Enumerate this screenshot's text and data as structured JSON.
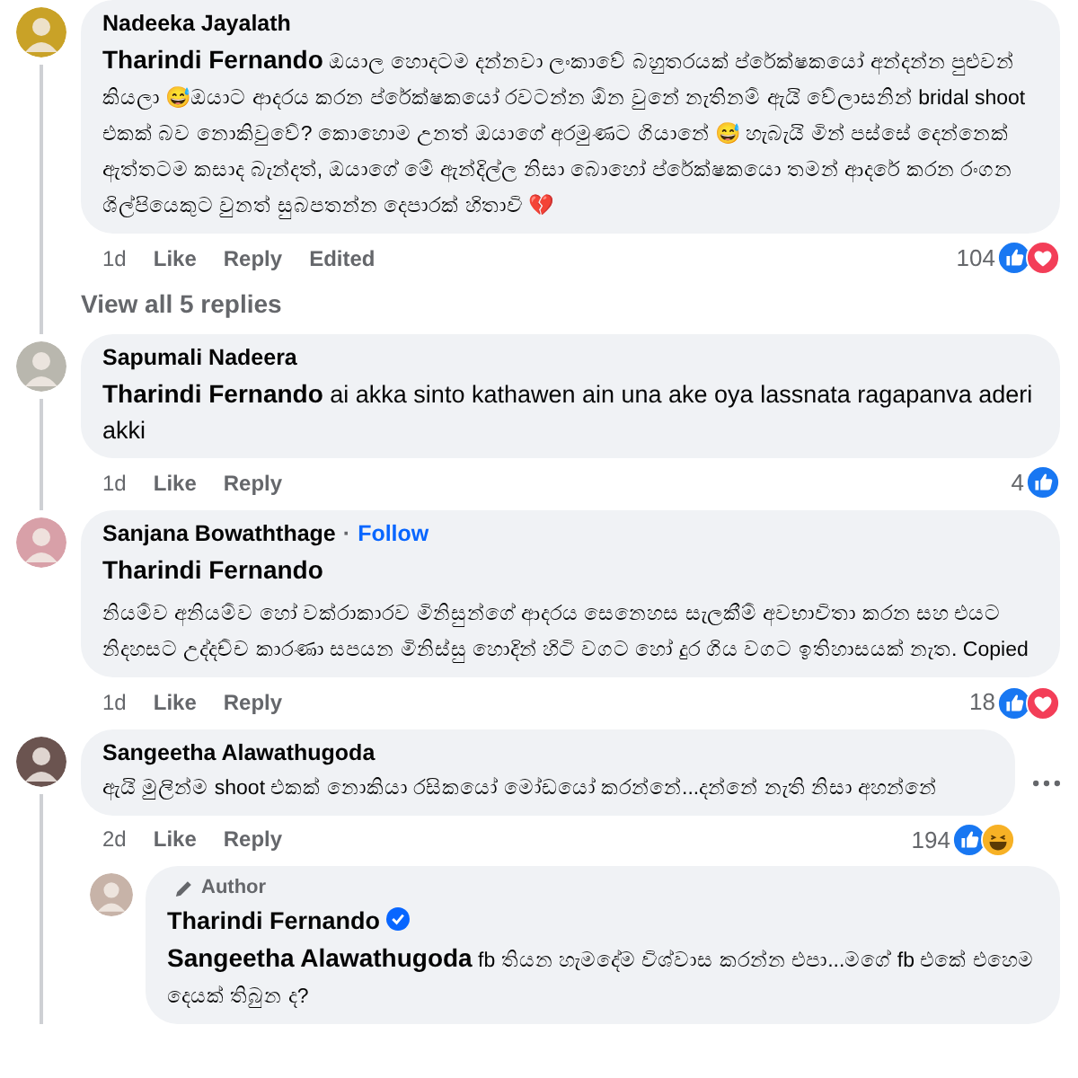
{
  "comments": [
    {
      "author": "Nadeeka Jayalath",
      "mention": "Tharindi Fernando",
      "mention_own_line": false,
      "text": "ඔයාල හොදටම දන්නවා ලංකාවේ බහුතරයක් ප්රේක්ෂකයෝ අන්දන්න පුළුවන් කියලා 😅ඔයාට ආදරය කරන ප්රේක්ෂකයෝ රවටන්න ඕන වුනේ නැතිනම් ඇයි වේලාසනින් bridal shoot එකක් බව නොකිවුවේ? කොහොම උනත් ඔයාගේ අරමුණට ගියානේ 😅 හැබැයි මින් පස්සේ දෙන්නෙක් ඇත්තටම කසාද බැන්දත්, ඔයාගේ මේ ඇන්දිල්ල නිසා බොහෝ ප්රේක්ෂකයො තමන් ආදරේ කරන රංගන ශිල්පියෙකුට වුනත් සුබපතන්න දෙපාරක් හිතාවි 💔",
      "time": "1d",
      "actions": [
        "Like",
        "Reply"
      ],
      "edited": "Edited",
      "reaction_count": "104",
      "reactions": [
        {
          "kind": "like"
        },
        {
          "kind": "love"
        }
      ],
      "thread_line": true,
      "replies_link": "View all 5 replies"
    },
    {
      "author": "Sapumali Nadeera",
      "mention": "Tharindi Fernando",
      "mention_own_line": false,
      "text": "ai akka sinto kathawen ain una ake oya lassnata ragapanva aderi akki",
      "time": "1d",
      "actions": [
        "Like",
        "Reply"
      ],
      "reaction_count": "4",
      "reactions": [
        {
          "kind": "like"
        }
      ],
      "thread_line": true
    },
    {
      "author": "Sanjana Bowaththage",
      "separator": "·",
      "follow": "Follow",
      "mention": "Tharindi Fernando",
      "mention_own_line": true,
      "text": "නියම්ව අනියම්ව හෝ වක්රාකාරව මිනිසුන්ගේ ආදරය සෙනෙහස සැලකීම් අවභාවිතා කරන සහ එයට නිදහසට උද්දච්ච කාරණා සපයන මිනිස්සු හොදින් හිටි වගට හෝ දුර ගිය වගට ඉතිහාසයක් නැත. Copied",
      "time": "1d",
      "actions": [
        "Like",
        "Reply"
      ],
      "reaction_count": "18",
      "reactions": [
        {
          "kind": "like"
        },
        {
          "kind": "love"
        }
      ],
      "thread_line": false
    },
    {
      "author": "Sangeetha Alawathugoda",
      "text": "ඇයි මුලින්ම shoot එකක් නොකියා රසිකයෝ මෝඩයෝ කරන්නේ...දන්නේ නැති නිසා අහන්නේ",
      "time": "2d",
      "actions": [
        "Like",
        "Reply"
      ],
      "reaction_count": "194",
      "reactions": [
        {
          "kind": "like"
        },
        {
          "kind": "haha"
        }
      ],
      "thread_line": true,
      "more_menu": true,
      "reply": {
        "badge": "Author",
        "author": "Tharindi Fernando",
        "verified": true,
        "mention": "Sangeetha Alawathugoda",
        "text": "fb තියන හැමදේම විශ්වාස කරන්න එපා...මගේ fb එකේ එහෙම දෙයක් තිබුන ද?"
      }
    }
  ]
}
